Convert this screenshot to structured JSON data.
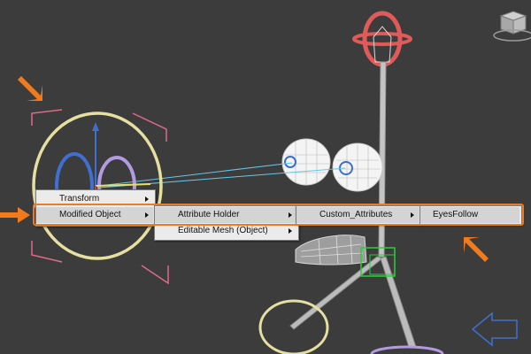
{
  "colors": {
    "viewport_bg": "#3c3c3c",
    "menu_bg": "#ebebeb",
    "menu_highlight": "#d4d4d4",
    "annotation_orange": "#f07a1c",
    "gizmo_red": "#e05a5a",
    "ring_yellow": "#e6e0a0",
    "ring_blue": "#3f6fd0",
    "ring_purple": "#b39be0",
    "selection_pink": "#e06a8a",
    "link_cyan": "#66c8e8",
    "bone_grey": "#c4c4c4",
    "bone_green": "#2ecc40"
  },
  "icons": {
    "view_cube": "view-cube-icon",
    "nav_arrow": "navigation-arrow-icon",
    "annotation_arrow": "orange-arrow-icon"
  },
  "context_menu": {
    "level1": [
      {
        "label": "Transform",
        "has_submenu": true
      },
      {
        "label": "Modified Object",
        "has_submenu": true,
        "highlighted": true
      }
    ],
    "level2": [
      {
        "label": "Attribute Holder",
        "has_submenu": true,
        "highlighted": true
      },
      {
        "label": "Editable Mesh (Object)",
        "has_submenu": true
      }
    ],
    "level3": [
      {
        "label": "Custom_Attributes",
        "has_submenu": true,
        "highlighted": true
      }
    ],
    "level4": [
      {
        "label": "EyesFollow",
        "has_submenu": false,
        "highlighted": true
      }
    ]
  }
}
